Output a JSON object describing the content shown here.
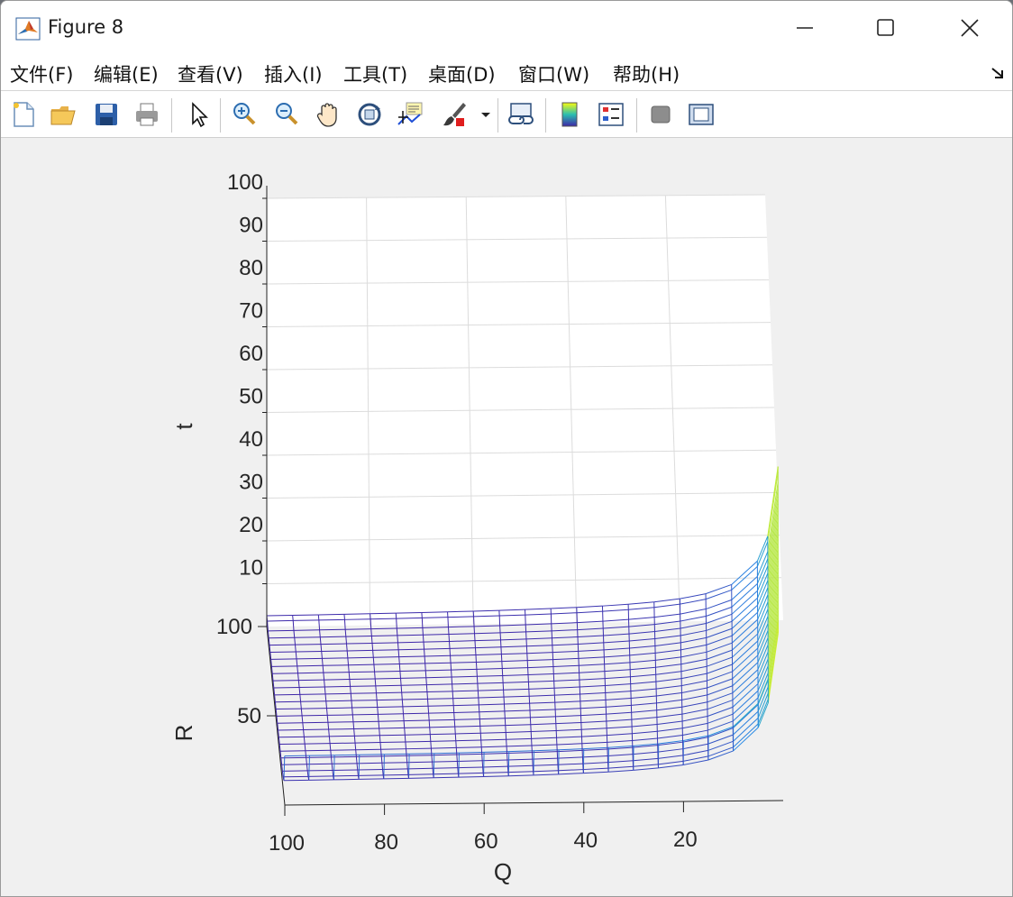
{
  "window": {
    "title": "Figure 8",
    "app_icon": "matlab-logo-icon",
    "controls": [
      "minimize-icon",
      "maximize-icon",
      "close-icon"
    ]
  },
  "menu": {
    "items": [
      {
        "label": "文件(F)"
      },
      {
        "label": "编辑(E)"
      },
      {
        "label": "查看(V)"
      },
      {
        "label": "插入(I)"
      },
      {
        "label": "工具(T)"
      },
      {
        "label": "桌面(D)"
      },
      {
        "label": "窗口(W)"
      },
      {
        "label": "帮助(H)"
      }
    ],
    "dock_icon": "dock-arrow-icon"
  },
  "toolbar": {
    "buttons": [
      "new-figure-icon",
      "open-file-icon",
      "save-icon",
      "print-icon",
      "edit-plot-icon",
      "zoom-in-icon",
      "zoom-out-icon",
      "pan-icon",
      "rotate-3d-icon",
      "data-cursor-icon",
      "brush-icon",
      "brush-dropdown-icon",
      "link-plot-icon",
      "colorbar-icon",
      "legend-icon",
      "hide-plot-tools-icon",
      "show-plot-tools-icon"
    ]
  },
  "chart_data": {
    "type": "mesh",
    "title": "",
    "xlabel": "Q",
    "ylabel": "R",
    "zlabel": "t",
    "x_ticks": [
      "100",
      "80",
      "60",
      "40",
      "20"
    ],
    "y_ticks": [
      "100",
      "50"
    ],
    "z_ticks": [
      "100",
      "90",
      "80",
      "70",
      "60",
      "50",
      "40",
      "30",
      "20",
      "10"
    ],
    "xlim": [
      0,
      100
    ],
    "ylim": [
      0,
      100
    ],
    "zlim": [
      0,
      100
    ],
    "x_direction": "reversed",
    "grid": true,
    "colormap": "parula",
    "colors": {
      "low": "#3e26a8",
      "mid": "#2bbfb0",
      "high": "#f9fb0e"
    }
  }
}
